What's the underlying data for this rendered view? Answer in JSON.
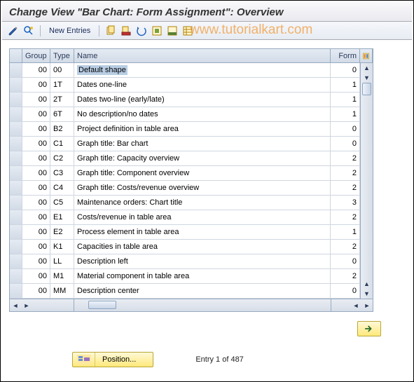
{
  "title": "Change View \"Bar Chart: Form Assignment\": Overview",
  "watermark": "www.tutorialkart.com",
  "toolbar": {
    "new_entries": "New Entries"
  },
  "columns": {
    "group": "Group",
    "type": "Type",
    "name": "Name",
    "form": "Form"
  },
  "rows": [
    {
      "group": "00",
      "type": "00",
      "name": "Default shape",
      "form": "0",
      "highlight": true
    },
    {
      "group": "00",
      "type": "1T",
      "name": "Dates one-line",
      "form": "1"
    },
    {
      "group": "00",
      "type": "2T",
      "name": "Dates two-line (early/late)",
      "form": "1"
    },
    {
      "group": "00",
      "type": "6T",
      "name": "No description/no dates",
      "form": "1"
    },
    {
      "group": "00",
      "type": "B2",
      "name": "Project definition in table area",
      "form": "0"
    },
    {
      "group": "00",
      "type": "C1",
      "name": "Graph title: Bar chart",
      "form": "0"
    },
    {
      "group": "00",
      "type": "C2",
      "name": "Graph title: Capacity overview",
      "form": "2"
    },
    {
      "group": "00",
      "type": "C3",
      "name": "Graph title: Component overview",
      "form": "2"
    },
    {
      "group": "00",
      "type": "C4",
      "name": "Graph title: Costs/revenue overview",
      "form": "2"
    },
    {
      "group": "00",
      "type": "C5",
      "name": "Maintenance orders: Chart title",
      "form": "3"
    },
    {
      "group": "00",
      "type": "E1",
      "name": "Costs/revenue in table area",
      "form": "2"
    },
    {
      "group": "00",
      "type": "E2",
      "name": "Process element in table area",
      "form": "1"
    },
    {
      "group": "00",
      "type": "K1",
      "name": "Capacities in table area",
      "form": "2"
    },
    {
      "group": "00",
      "type": "LL",
      "name": "Description left",
      "form": "0"
    },
    {
      "group": "00",
      "type": "M1",
      "name": "Material component in table area",
      "form": "2"
    },
    {
      "group": "00",
      "type": "MM",
      "name": "Description center",
      "form": "0"
    }
  ],
  "footer": {
    "position_label": "Position...",
    "entry_label": "Entry 1 of 487"
  }
}
